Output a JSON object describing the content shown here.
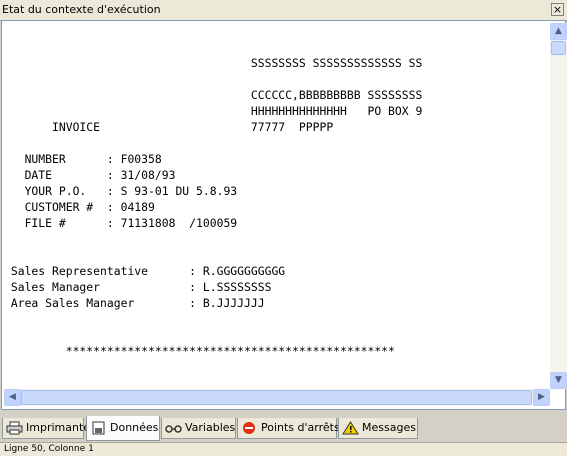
{
  "window": {
    "title": "Etat du contexte d'exécution"
  },
  "document": {
    "lines": [
      "",
      "",
      "                                    SSSSSSSS SSSSSSSSSSSSS SS",
      "",
      "                                    CCCCCC,BBBBBBBBB SSSSSSSS",
      "                                    HHHHHHHHHHHHHH   PO BOX 9",
      "       INVOICE                      77777  PPPPP",
      "",
      "   NUMBER      : F00358",
      "   DATE        : 31/08/93",
      "   YOUR P.O.   : S 93-01 DU 5.8.93",
      "   CUSTOMER #  : 04189",
      "   FILE #      : 71131808  /100059",
      "",
      "",
      " Sales Representative      : R.GGGGGGGGGG",
      " Sales Manager             : L.SSSSSSSS",
      " Area Sales Manager        : B.JJJJJJJ",
      "",
      "",
      "         ************************************************"
    ]
  },
  "tabs": [
    {
      "label": "Imprimante",
      "icon": "printer-icon",
      "active": false
    },
    {
      "label": "Données",
      "icon": "data-icon",
      "active": true
    },
    {
      "label": "Variables",
      "icon": "variables-icon",
      "active": false
    },
    {
      "label": "Points d'arrêts",
      "icon": "breakpoint-icon",
      "active": false
    },
    {
      "label": "Messages",
      "icon": "warning-icon",
      "active": false
    }
  ],
  "status": {
    "text": "Ligne 50, Colonne 1"
  },
  "icons": {
    "close": "close-icon",
    "scroll_up": "arrow-up-icon",
    "scroll_down": "arrow-down-icon",
    "scroll_left": "arrow-left-icon",
    "scroll_right": "arrow-right-icon"
  }
}
